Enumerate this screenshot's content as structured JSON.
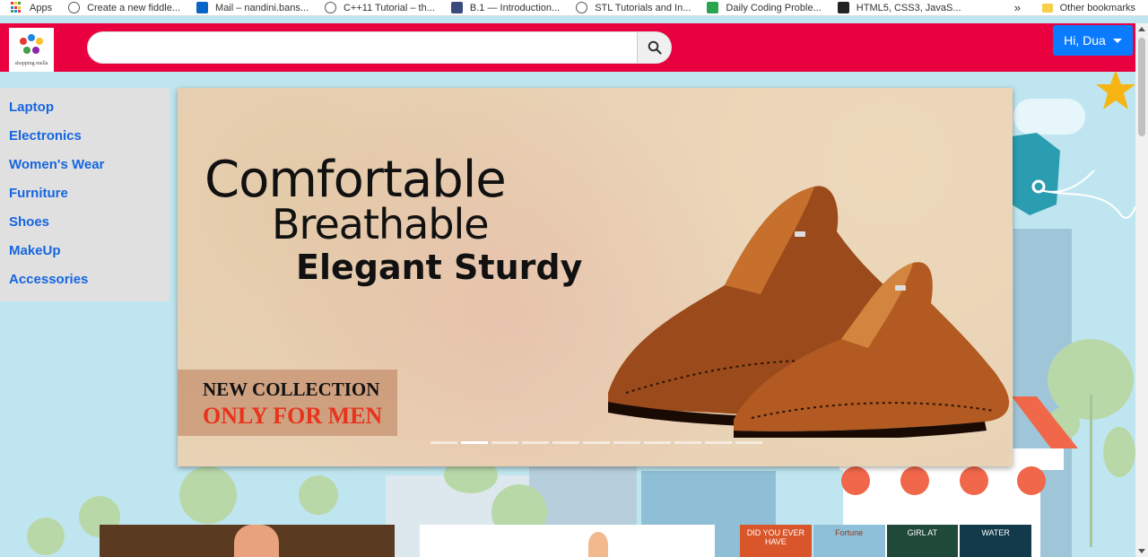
{
  "bookmarks": {
    "items": [
      {
        "label": "Apps",
        "icon": "apps-grid-icon"
      },
      {
        "label": "Create a new fiddle...",
        "icon": "globe-icon"
      },
      {
        "label": "Mail – nandini.bans...",
        "icon": "outlook-icon"
      },
      {
        "label": "C++11 Tutorial – th...",
        "icon": "globe-icon"
      },
      {
        "label": "B.1 — Introduction...",
        "icon": "cpp-icon"
      },
      {
        "label": "STL Tutorials and In...",
        "icon": "globe-icon"
      },
      {
        "label": "Daily Coding Proble...",
        "icon": "green-doc-icon"
      },
      {
        "label": "HTML5, CSS3, JavaS...",
        "icon": "code-icon"
      }
    ],
    "more": "»",
    "other": "Other bookmarks"
  },
  "header": {
    "logo_text": "shopping mella",
    "search": {
      "placeholder": "",
      "value": ""
    },
    "user_label": "Hi, Dua"
  },
  "sidebar": {
    "items": [
      {
        "label": "Laptop"
      },
      {
        "label": "Electronics"
      },
      {
        "label": "Women's Wear"
      },
      {
        "label": "Furniture"
      },
      {
        "label": "Shoes"
      },
      {
        "label": "MakeUp"
      },
      {
        "label": "Accessories"
      }
    ]
  },
  "banner": {
    "line1": "Comfortable",
    "line2": "Breathable",
    "line3": "Elegant Sturdy",
    "collection": "NEW COLLECTION",
    "tagline": "ONLY FOR MEN",
    "slides_count": 11,
    "active_slide": 2
  },
  "books": [
    {
      "text": "DID YOU EVER HAVE",
      "color": "#d9562b"
    },
    {
      "text": "Fortune",
      "color": "#8fc0d9"
    },
    {
      "text": "GIRL AT",
      "color": "#1f4a3a"
    },
    {
      "text": "WATER",
      "color": "#123a4a"
    }
  ],
  "colors": {
    "header": "#e8003f",
    "user_button": "#0a7bff",
    "sidebar_link": "#1565e0",
    "tagline": "#e8341c"
  }
}
